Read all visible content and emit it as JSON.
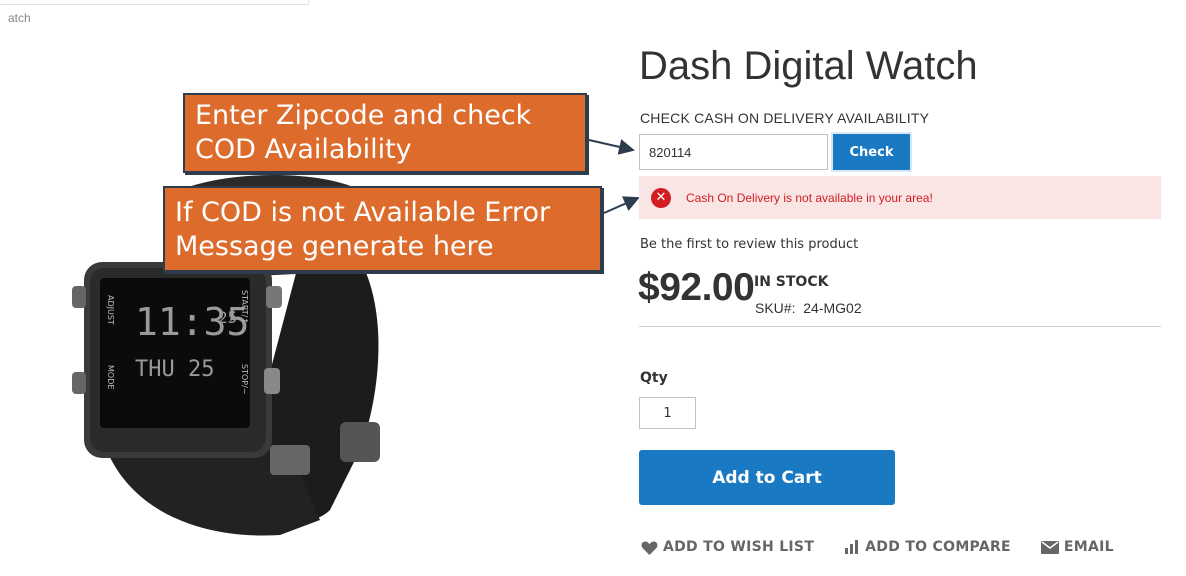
{
  "breadcrumb": {
    "text": "atch"
  },
  "product": {
    "title": "Dash Digital Watch",
    "price": "$92.00",
    "stock": "IN STOCK",
    "sku_label": "SKU#:",
    "sku_value": "24-MG02",
    "review_text": "Be the first to review this product"
  },
  "cod": {
    "label": "CHECK CASH ON DELIVERY AVAILABILITY",
    "zipcode_value": "820114",
    "check_button": "Check",
    "error_message": "Cash On Delivery is not available in your area!"
  },
  "qty": {
    "label": "Qty",
    "value": "1"
  },
  "cart": {
    "add_button": "Add to Cart"
  },
  "actions": {
    "wishlist": "ADD TO WISH LIST",
    "compare": "ADD TO COMPARE",
    "email": "EMAIL"
  },
  "callouts": {
    "zip_line1": "Enter Zipcode and check",
    "zip_line2": "COD Availability",
    "err_line1": "If COD is not Available Error",
    "err_line2": "Message generate here"
  },
  "watch_display": {
    "time": "11:35",
    "seconds": "25",
    "day": "THU 25",
    "adjust": "ADJUST",
    "start": "START/↑",
    "stop": "STOP/−",
    "mode": "MODE"
  },
  "icons": {
    "error": "x-circle-icon",
    "wishlist": "heart-icon",
    "compare": "bar-chart-icon",
    "email": "envelope-icon"
  },
  "colors": {
    "accent": "#1979c3",
    "error": "#d21c22",
    "error_bg": "#fae5e5",
    "callout": "#dc6b2c",
    "callout_border": "#2e3d4e"
  }
}
